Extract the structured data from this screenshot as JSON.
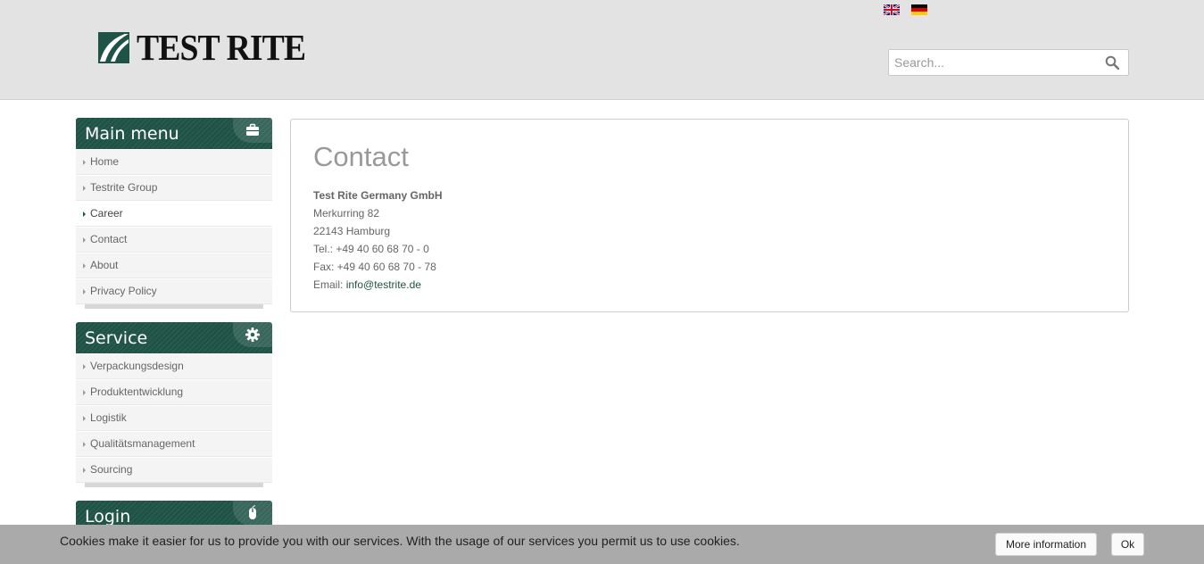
{
  "header": {
    "logo_text": "TEST RITE",
    "languages": [
      {
        "name": "English",
        "icon": "uk-flag-icon"
      },
      {
        "name": "Deutsch",
        "icon": "german-flag-icon"
      }
    ],
    "search": {
      "placeholder": "Search...",
      "icon": "search-icon"
    }
  },
  "sidebar": {
    "main_menu": {
      "title": "Main menu",
      "icon": "briefcase-icon",
      "items": [
        {
          "label": "Home"
        },
        {
          "label": "Testrite Group"
        },
        {
          "label": "Career"
        },
        {
          "label": "Contact"
        },
        {
          "label": "About"
        },
        {
          "label": "Privacy Policy"
        }
      ]
    },
    "service": {
      "title": "Service",
      "icon": "gear-icon",
      "items": [
        {
          "label": "Verpackungsdesign"
        },
        {
          "label": "Produktentwicklung"
        },
        {
          "label": "Logistik"
        },
        {
          "label": "Qualitätsmanagement"
        },
        {
          "label": "Sourcing"
        }
      ]
    },
    "login": {
      "title": "Login",
      "icon": "mouse-icon"
    }
  },
  "content": {
    "title": "Contact",
    "company": "Test Rite Germany GmbH",
    "street": "Merkurring 82",
    "city": "22143 Hamburg",
    "tel": "Tel.: +49 40 60 68 70 - 0",
    "fax": "Fax: +49 40 60 68 70 - 78",
    "email_label": "Email: ",
    "email": "info@testrite.de"
  },
  "cookie_bar": {
    "text": "Cookies make it easier for us to provide you with our services. With the usage of our services you permit us to use cookies.",
    "more_label": "More information",
    "ok_label": "Ok"
  },
  "colors": {
    "brand_green": "#1f5346",
    "header_bg": "#e3e3e3",
    "cookie_bg": "#aaaaaa"
  }
}
